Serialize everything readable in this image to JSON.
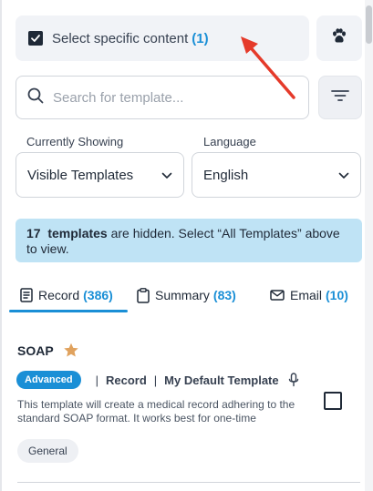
{
  "select_specific": {
    "label": "Select specific content",
    "count": "(1)"
  },
  "search": {
    "placeholder": "Search for template..."
  },
  "filters": {
    "showing_label": "Currently Showing",
    "showing_value": "Visible Templates",
    "language_label": "Language",
    "language_value": "English"
  },
  "notice": {
    "count": "17",
    "bold_text": "templates",
    "rest": " are hidden. Select “All Templates” above to view."
  },
  "tabs": [
    {
      "label": "Record",
      "count": "(386)",
      "icon": "document-icon",
      "active": true
    },
    {
      "label": "Summary",
      "count": "(83)",
      "icon": "clipboard-icon",
      "active": false
    },
    {
      "label": "Email",
      "count": "(10)",
      "icon": "mail-icon",
      "active": false
    }
  ],
  "card": {
    "title": "SOAP",
    "badge": "Advanced",
    "type": "Record",
    "default_label": "My Default Template",
    "description": "This template will create a medical record adhering to the standard SOAP format. It works best for one-time",
    "tag": "General"
  },
  "colors": {
    "accent": "#1a8fd6",
    "star": "#e0a25e",
    "arrow": "#e53a2a",
    "notice_bg": "#bfe3f5"
  }
}
